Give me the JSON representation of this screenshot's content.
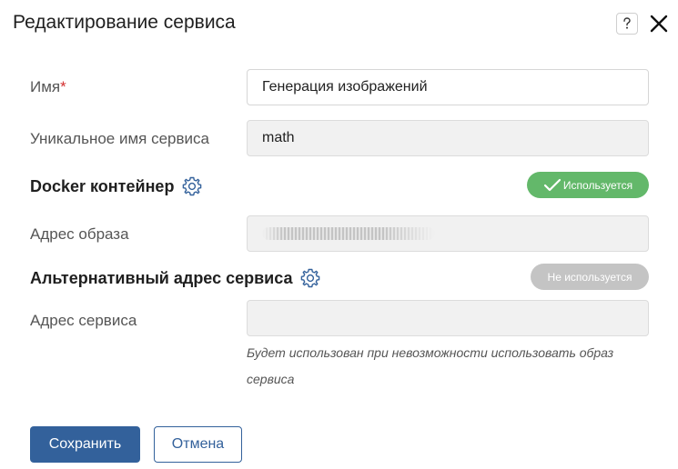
{
  "dialog": {
    "title": "Редактирование сервиса",
    "help_icon": "question-mark-icon",
    "close_icon": "close-icon"
  },
  "fields": {
    "name": {
      "label": "Имя",
      "required_mark": "*",
      "value": "Генерация изображений"
    },
    "unique_name": {
      "label": "Уникальное имя сервиса",
      "value": "math"
    },
    "image_address": {
      "label": "Адрес образа"
    },
    "service_address": {
      "label": "Адрес сервиса",
      "value": "",
      "hint": "Будет использован при невозможности использовать образ сервиса"
    }
  },
  "docker": {
    "title": "Docker контейнер",
    "status": "Используется",
    "status_color": "#63b86a"
  },
  "alternative": {
    "title": "Альтернативный адрес сервиса",
    "status": "Не используется",
    "status_color": "#c4c4c4"
  },
  "actions": {
    "save_label": "Сохранить",
    "cancel_label": "Отмена"
  },
  "colors": {
    "primary": "#33619b",
    "required": "#d32f2f",
    "gear": "#33619b"
  }
}
